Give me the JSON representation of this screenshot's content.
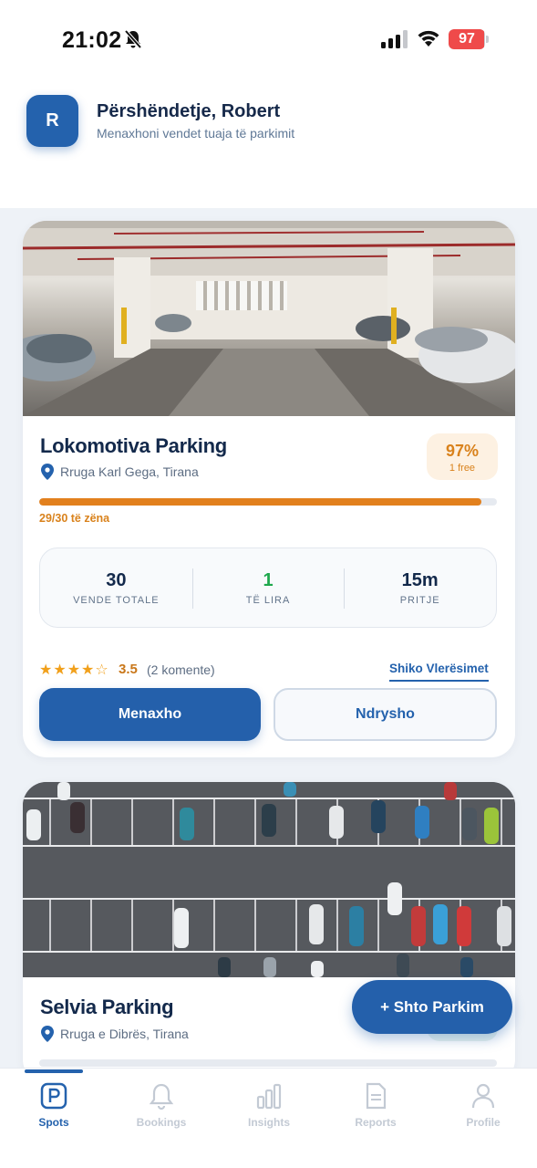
{
  "status_bar": {
    "time": "21:02",
    "battery": "97",
    "battery_level": 0.97
  },
  "header": {
    "avatar_initial": "R",
    "greeting": "Përshëndetje, Robert",
    "subtitle": "Menaxhoni vendet tuaja të parkimit"
  },
  "parkings": [
    {
      "name": "Lokomotiva Parking",
      "address": "Rruga Karl Gega, Tirana",
      "occupancy_percent": "97%",
      "free_label": "1 free",
      "occupancy_fraction": 0.967,
      "occupied_text": "29/30 të zëna",
      "stats": [
        {
          "value": "30",
          "label": "VENDE TOTALE"
        },
        {
          "value": "1",
          "label": "TË LIRA"
        },
        {
          "value": "15m",
          "label": "PRITJE"
        }
      ],
      "rating": "3.5",
      "rating_stars": 3.5,
      "reviews_count": "(2 komente)",
      "reviews_link": "Shiko Vlerësimet",
      "manage_label": "Menaxho",
      "edit_label": "Ndrysho"
    },
    {
      "name": "Selvia Parking",
      "address": "Rruga e Dibrës, Tirana"
    }
  ],
  "fab_label": "+ Shto Parkim",
  "tabs": [
    {
      "label": "Spots",
      "icon": "parking-icon",
      "active": true
    },
    {
      "label": "Bookings",
      "icon": "bell-icon"
    },
    {
      "label": "Insights",
      "icon": "bar-chart-icon"
    },
    {
      "label": "Reports",
      "icon": "document-icon"
    },
    {
      "label": "Profile",
      "icon": "person-icon"
    }
  ],
  "colors": {
    "primary": "#2460ab",
    "accent_orange": "#e2801d",
    "green": "#1fa84d"
  }
}
